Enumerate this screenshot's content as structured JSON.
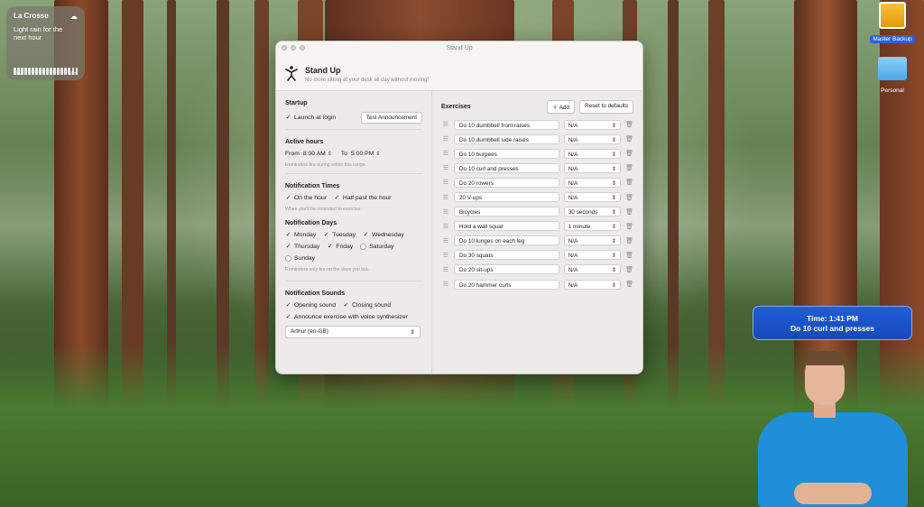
{
  "widget": {
    "city": "La Crosse",
    "description": "Light rain for the next hour",
    "time_start": "Now",
    "time_end": "60m",
    "icon": "rain-cloud-icon"
  },
  "desktop": {
    "icons": [
      {
        "label": "Master Backup",
        "icon": "drive-icon",
        "selected": true
      },
      {
        "label": "Personal",
        "icon": "folder-icon",
        "selected": false
      }
    ]
  },
  "notification": {
    "line1": "Time: 1:41 PM",
    "line2": "Do 10 curl and presses"
  },
  "window": {
    "title": "Stand Up",
    "app_name": "Stand Up",
    "tagline": "No more sitting at your desk all day without moving!"
  },
  "startup": {
    "title": "Startup",
    "launch_label": "Launch at login",
    "test_button": "Test Announcement"
  },
  "active_hours": {
    "title": "Active hours",
    "from_label": "From",
    "from_value": "8:00 AM",
    "to_label": "To",
    "to_value": "5:00 PM",
    "hint": "Reminders fire during within this range."
  },
  "notification_times": {
    "title": "Notification Times",
    "on_hour": "On the hour",
    "half_past": "Half past the hour",
    "hint": "When you'll be reminded to exercise."
  },
  "notification_days": {
    "title": "Notification Days",
    "days": [
      {
        "label": "Monday",
        "checked": true
      },
      {
        "label": "Tuesday",
        "checked": true
      },
      {
        "label": "Wednesday",
        "checked": true
      },
      {
        "label": "Thursday",
        "checked": true
      },
      {
        "label": "Friday",
        "checked": true
      },
      {
        "label": "Saturday",
        "checked": false
      },
      {
        "label": "Sunday",
        "checked": false
      }
    ],
    "hint": "Reminders only fire on the days you tick."
  },
  "notification_sounds": {
    "title": "Notification Sounds",
    "opening": "Opening sound",
    "closing": "Closing sound",
    "announce": "Announce exercise with voice synthesizer",
    "voice": "Arthur (en-GB)"
  },
  "exercises": {
    "title": "Exercises",
    "add_button": "Add",
    "reset_button": "Reset to defaults",
    "items": [
      {
        "name": "Do 10 dumbbell front raises",
        "duration": "N/A"
      },
      {
        "name": "Do 10 dumbbell side raises",
        "duration": "N/A"
      },
      {
        "name": "Do 10 burpees",
        "duration": "N/A"
      },
      {
        "name": "Do 10 curl and presses",
        "duration": "N/A"
      },
      {
        "name": "Do 20 rowers",
        "duration": "N/A"
      },
      {
        "name": "20 V-ups",
        "duration": "N/A"
      },
      {
        "name": "Bicycles",
        "duration": "30 seconds"
      },
      {
        "name": "Hold a wall squat",
        "duration": "1 minute"
      },
      {
        "name": "Do 10 lunges on each leg",
        "duration": "N/A"
      },
      {
        "name": "Do 30 squats",
        "duration": "N/A"
      },
      {
        "name": "Do 20 sit-ups",
        "duration": "N/A"
      },
      {
        "name": "Do 20 hammer curls",
        "duration": "N/A"
      }
    ]
  }
}
